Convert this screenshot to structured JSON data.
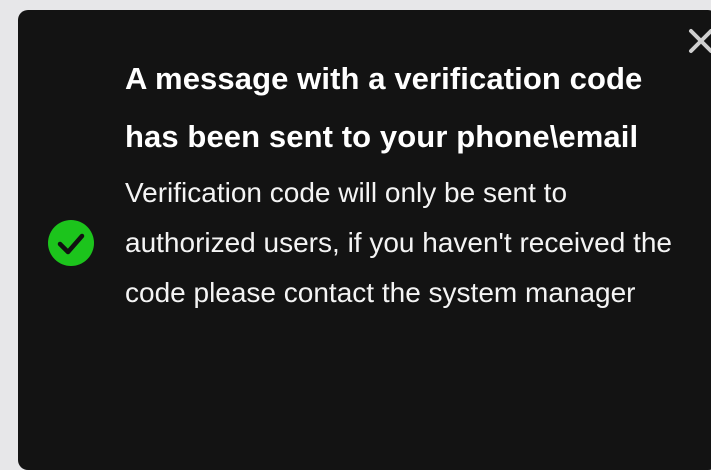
{
  "toast": {
    "status": "success",
    "status_icon": "check-circle-icon",
    "close_icon": "close-icon",
    "title": "A message with a verification code has been sent to your phone\\email",
    "message": "Verification code will only be sent to authorized users, if you haven't received the code please contact the system manager",
    "colors": {
      "background": "#131313",
      "text": "#ffffff",
      "success": "#1cc41c",
      "close": "#cfcfcf"
    }
  }
}
